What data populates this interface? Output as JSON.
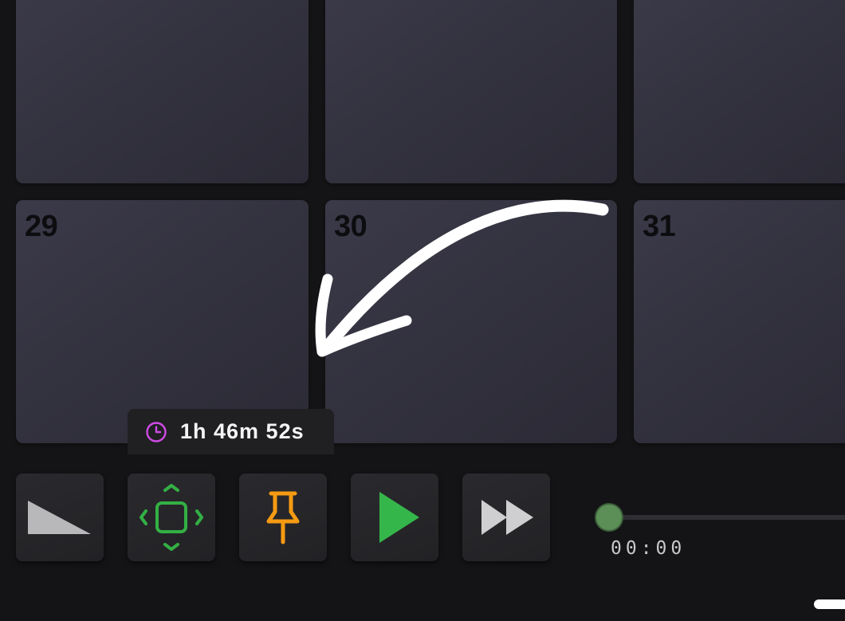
{
  "calendar": {
    "days": [
      {
        "label": ""
      },
      {
        "label": ""
      },
      {
        "label": ""
      },
      {
        "label": "29"
      },
      {
        "label": "30"
      },
      {
        "label": "31"
      }
    ]
  },
  "timer": {
    "elapsed": "1h 46m 52s",
    "icon": "clock-icon",
    "icon_color": "#d04be6"
  },
  "toolbar": {
    "buttons": [
      {
        "name": "ramp-tool",
        "icon": "ramp-icon",
        "color": "#b8b8bb"
      },
      {
        "name": "move-tool",
        "icon": "move-resize-icon",
        "color": "#33b044"
      },
      {
        "name": "pin-tool",
        "icon": "pushpin-icon",
        "color": "#f59a12"
      },
      {
        "name": "play",
        "icon": "play-icon",
        "color": "#35b64a"
      },
      {
        "name": "fast-forward",
        "icon": "fast-forward-icon",
        "color": "#cfcfd2"
      }
    ]
  },
  "playback": {
    "position": 0,
    "time": "00:00",
    "knob_color": "#5b8f57"
  },
  "colors": {
    "background": "#141416",
    "tile": "#353443",
    "annotation_arrow": "#ffffff"
  }
}
